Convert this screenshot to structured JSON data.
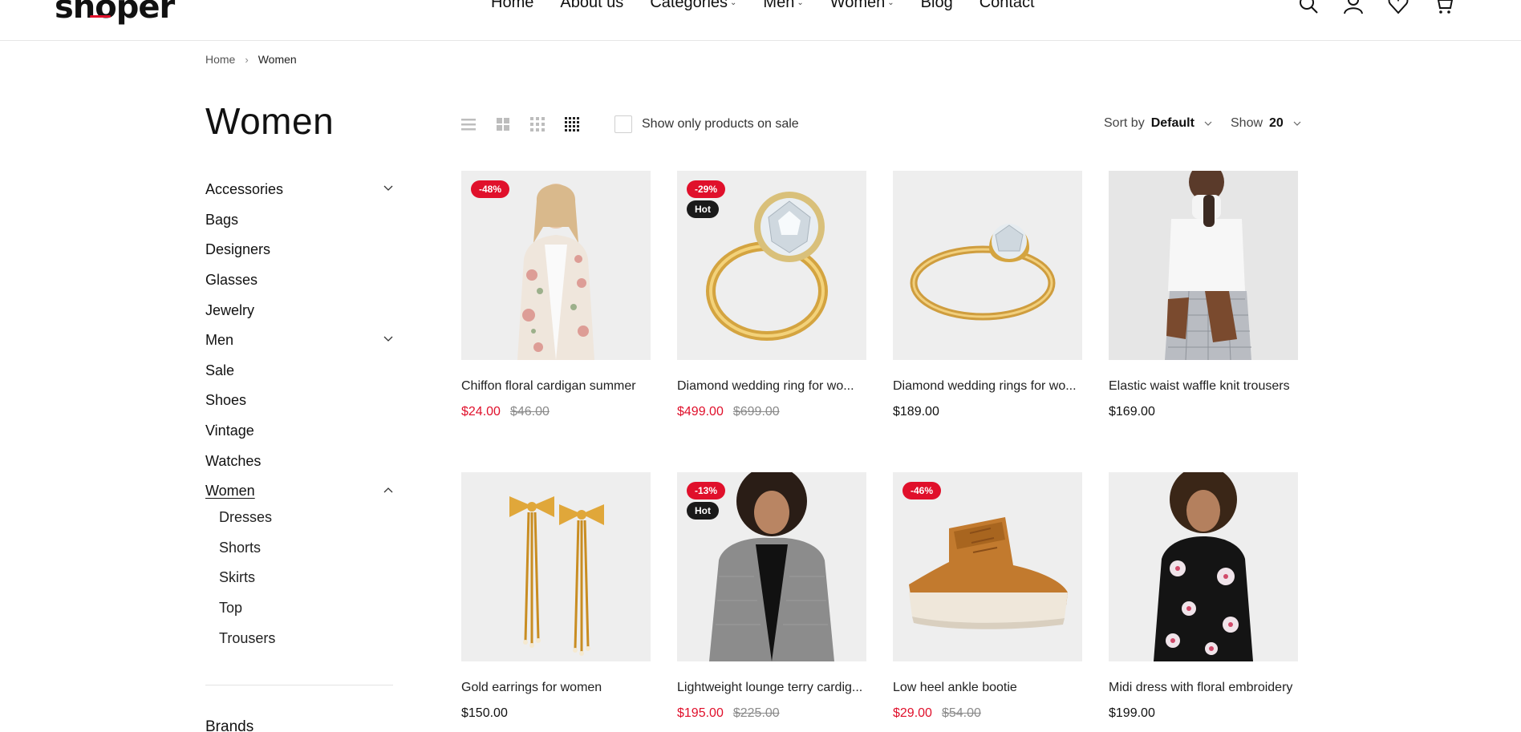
{
  "header": {
    "logo": "shoper",
    "nav": [
      {
        "label": "Home",
        "has_dropdown": false
      },
      {
        "label": "About us",
        "has_dropdown": false
      },
      {
        "label": "Categories",
        "has_dropdown": true
      },
      {
        "label": "Men",
        "has_dropdown": true
      },
      {
        "label": "Women",
        "has_dropdown": true
      },
      {
        "label": "Blog",
        "has_dropdown": false
      },
      {
        "label": "Contact",
        "has_dropdown": false
      }
    ],
    "icons": [
      "search-icon",
      "user-icon",
      "heart-icon",
      "cart-icon"
    ]
  },
  "breadcrumb": {
    "home": "Home",
    "separator": "›",
    "current": "Women"
  },
  "sidebar": {
    "title": "Women",
    "categories": [
      {
        "label": "Accessories",
        "chevron": "down"
      },
      {
        "label": "Bags",
        "chevron": ""
      },
      {
        "label": "Designers",
        "chevron": ""
      },
      {
        "label": "Glasses",
        "chevron": ""
      },
      {
        "label": "Jewelry",
        "chevron": ""
      },
      {
        "label": "Men",
        "chevron": "down"
      },
      {
        "label": "Sale",
        "chevron": ""
      },
      {
        "label": "Shoes",
        "chevron": ""
      },
      {
        "label": "Vintage",
        "chevron": ""
      },
      {
        "label": "Watches",
        "chevron": ""
      },
      {
        "label": "Women",
        "chevron": "up",
        "active": true
      }
    ],
    "subcategories": [
      "Dresses",
      "Shorts",
      "Skirts",
      "Top",
      "Trousers"
    ],
    "brands_title": "Brands"
  },
  "toolbar": {
    "sale_only_label": "Show only products on sale",
    "sale_only_checked": false,
    "sort_label": "Sort by",
    "sort_value": "Default",
    "show_label": "Show",
    "show_value": "20"
  },
  "colors": {
    "accent": "#e0102b",
    "hot_badge": "#1a1a1a",
    "image_bg": "#efefef"
  },
  "products": [
    {
      "name": "Chiffon floral cardigan summer",
      "price": "$24.00",
      "old_price": "$46.00",
      "sale_badge": "-48%",
      "hot_badge": ""
    },
    {
      "name": "Diamond wedding ring for wo...",
      "price": "$499.00",
      "old_price": "$699.00",
      "sale_badge": "-29%",
      "hot_badge": "Hot"
    },
    {
      "name": "Diamond wedding rings for wo...",
      "price": "$189.00",
      "old_price": "",
      "sale_badge": "",
      "hot_badge": ""
    },
    {
      "name": "Elastic waist waffle knit trousers",
      "price": "$169.00",
      "old_price": "",
      "sale_badge": "",
      "hot_badge": ""
    },
    {
      "name": "Gold earrings for women",
      "price": "$150.00",
      "old_price": "",
      "sale_badge": "",
      "hot_badge": ""
    },
    {
      "name": "Lightweight lounge terry cardig...",
      "price": "$195.00",
      "old_price": "$225.00",
      "sale_badge": "-13%",
      "hot_badge": "Hot"
    },
    {
      "name": "Low heel ankle bootie",
      "price": "$29.00",
      "old_price": "$54.00",
      "sale_badge": "-46%",
      "hot_badge": ""
    },
    {
      "name": "Midi dress with floral embroidery",
      "price": "$199.00",
      "old_price": "",
      "sale_badge": "",
      "hot_badge": ""
    }
  ]
}
